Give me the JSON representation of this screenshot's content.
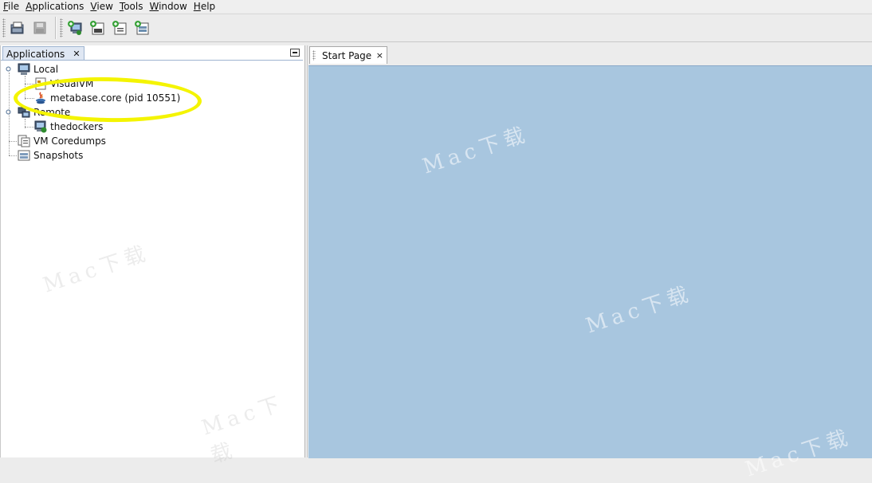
{
  "menubar": {
    "items": [
      {
        "mnemonic": "F",
        "rest": "ile"
      },
      {
        "mnemonic": "A",
        "rest": "pplications"
      },
      {
        "mnemonic": "V",
        "rest": "iew"
      },
      {
        "mnemonic": "T",
        "rest": "ools"
      },
      {
        "mnemonic": "W",
        "rest": "indow"
      },
      {
        "mnemonic": "H",
        "rest": "elp"
      }
    ]
  },
  "left_panel": {
    "tab_label": "Applications",
    "tab_close": "✕"
  },
  "tree": {
    "local": "Local",
    "visualvm": "VisualVM",
    "metabase": "metabase.core (pid 10551)",
    "remote": "Remote",
    "thedockers": "thedockers",
    "vm_coredumps": "VM Coredumps",
    "snapshots": "Snapshots"
  },
  "right_panel": {
    "tab_label": "Start Page",
    "tab_close": "×"
  },
  "watermark": {
    "text": "Mac下载",
    "url": "www.Macdown.com"
  },
  "colors": {
    "content_bg": "#a8c6df",
    "highlight": "#f4f400",
    "tab_active_bg": "#dfe7f3"
  }
}
